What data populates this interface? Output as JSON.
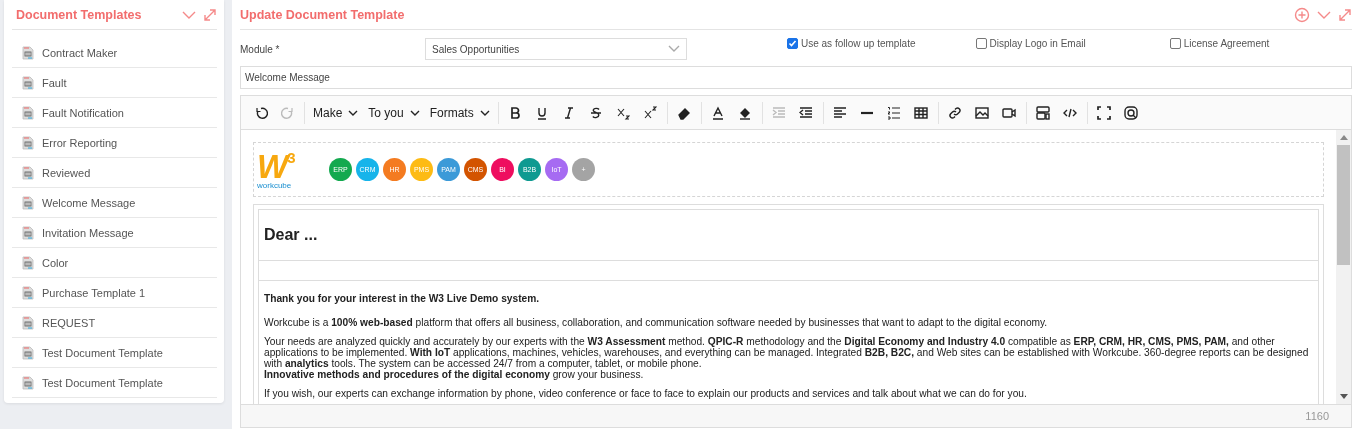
{
  "sidebar": {
    "title": "Document Templates",
    "items": [
      {
        "label": "Contract Maker"
      },
      {
        "label": "Fault"
      },
      {
        "label": "Fault Notification"
      },
      {
        "label": "Error Reporting"
      },
      {
        "label": "Reviewed"
      },
      {
        "label": "Welcome Message"
      },
      {
        "label": "Invitation Message"
      },
      {
        "label": "Color"
      },
      {
        "label": "Purchase Template 1"
      },
      {
        "label": "REQUEST"
      },
      {
        "label": "Test Document Template"
      },
      {
        "label": "Test Document Template"
      }
    ]
  },
  "form": {
    "title": "Update Document Template",
    "module_label": "Module *",
    "module_value": "Sales Opportunities",
    "checkboxes": [
      {
        "label": "Use as follow up template",
        "checked": true
      },
      {
        "label": "Display Logo in Email",
        "checked": false
      },
      {
        "label": "License Agreement",
        "checked": false
      }
    ],
    "name_value": "Welcome Message"
  },
  "toolbar": {
    "history": [
      {
        "disabled": false
      },
      {
        "disabled": true
      }
    ],
    "dropdowns": [
      {
        "label": "Make"
      },
      {
        "label": "To you"
      },
      {
        "label": "Formats"
      }
    ],
    "buttons": [
      {
        "disabled": false
      },
      {
        "disabled": false
      },
      {
        "disabled": false
      },
      {
        "disabled": false
      },
      {
        "disabled": false
      },
      {
        "disabled": false
      },
      {
        "disabled": false
      },
      {
        "disabled": false
      },
      {
        "disabled": false
      },
      {
        "disabled": true
      },
      {
        "disabled": false
      },
      {
        "disabled": false
      },
      {
        "disabled": false
      },
      {
        "disabled": false
      },
      {
        "disabled": false
      },
      {
        "disabled": false
      },
      {
        "disabled": false
      },
      {
        "disabled": false
      },
      {
        "disabled": false
      },
      {
        "disabled": false
      },
      {
        "disabled": false
      },
      {
        "disabled": false
      }
    ]
  },
  "document": {
    "logo": {
      "mark": "W",
      "sup": "3",
      "name": "workcube"
    },
    "modules": [
      {
        "label": "ERP",
        "color": "#13a94f"
      },
      {
        "label": "CRM",
        "color": "#17b4ea"
      },
      {
        "label": "HR",
        "color": "#f47b20"
      },
      {
        "label": "PMS",
        "color": "#fdbb14"
      },
      {
        "label": "PAM",
        "color": "#3b9ad8"
      },
      {
        "label": "CMS",
        "color": "#d35400"
      },
      {
        "label": "BI",
        "color": "#ee0e5f"
      },
      {
        "label": "B2B",
        "color": "#0f9a91"
      },
      {
        "label": "IoT",
        "color": "#a66bf2"
      },
      {
        "label": "+",
        "color": "#a4a4a4"
      }
    ],
    "greeting": "Dear ...",
    "paragraphs": [
      [
        "**Thank you for your interest in the W3 Live Demo system.**"
      ],
      [
        "Workcube is a **100% web-based** platform that offers all business, collaboration, and communication software needed by businesses that want to adapt to the digital economy."
      ],
      [
        "Your needs are analyzed quickly and accurately by our experts with the  **W3 Assessment** method. **QPIC-R**  methodology and the  **Digital Economy and Industry 4.0**  compatible as  **ERP, CRM, HR, CMS, PMS, PAM,** and other applications to be implemented. **With IoT** applications, machines, vehicles, warehouses, and everything can be managed. Integrated  **B2B, B2C,** and Web sites can be established with Workcube. 360-degree reports can be designed with **analytics** tools. The system can be accessed 24/7 from a computer, tablet, or mobile phone.",
        "**Innovative methods and procedures of the digital economy** grow your business."
      ],
      [
        "If you wish, our experts can exchange information by phone, video conference or face to face to explain our products and services and talk about what we can do for you."
      ]
    ],
    "word_count": "1160"
  }
}
